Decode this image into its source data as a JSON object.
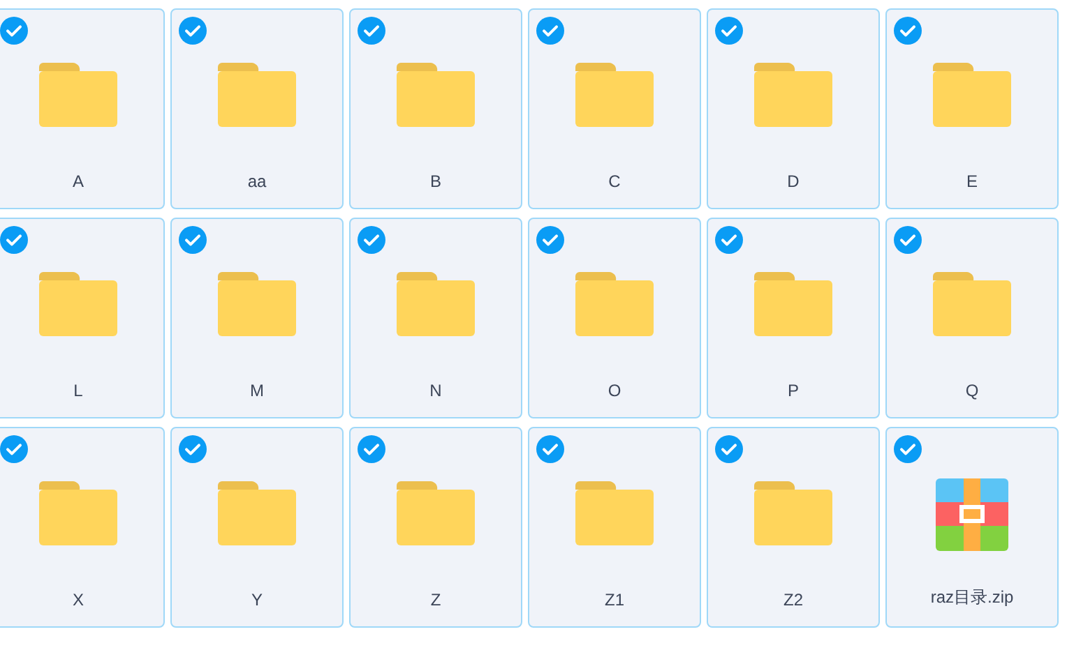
{
  "items": [
    {
      "kind": "folder",
      "name": "A",
      "selected": true
    },
    {
      "kind": "folder",
      "name": "aa",
      "selected": true
    },
    {
      "kind": "folder",
      "name": "B",
      "selected": true
    },
    {
      "kind": "folder",
      "name": "C",
      "selected": true
    },
    {
      "kind": "folder",
      "name": "D",
      "selected": true
    },
    {
      "kind": "folder",
      "name": "E",
      "selected": true
    },
    {
      "kind": "folder",
      "name": "L",
      "selected": true
    },
    {
      "kind": "folder",
      "name": "M",
      "selected": true
    },
    {
      "kind": "folder",
      "name": "N",
      "selected": true
    },
    {
      "kind": "folder",
      "name": "O",
      "selected": true
    },
    {
      "kind": "folder",
      "name": "P",
      "selected": true
    },
    {
      "kind": "folder",
      "name": "Q",
      "selected": true
    },
    {
      "kind": "folder",
      "name": "X",
      "selected": true
    },
    {
      "kind": "folder",
      "name": "Y",
      "selected": true
    },
    {
      "kind": "folder",
      "name": "Z",
      "selected": true
    },
    {
      "kind": "folder",
      "name": "Z1",
      "selected": true
    },
    {
      "kind": "folder",
      "name": "Z2",
      "selected": true
    },
    {
      "kind": "archive",
      "name": "raz目录.zip",
      "selected": true
    }
  ]
}
